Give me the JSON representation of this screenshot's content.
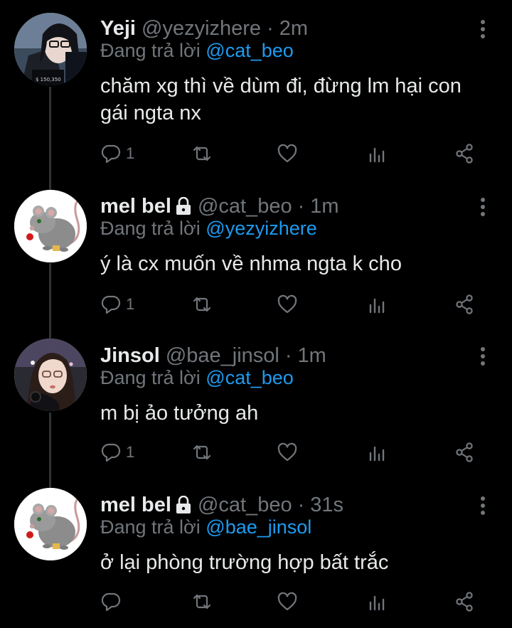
{
  "tweets": [
    {
      "name": "Yeji",
      "handle": "@yezyizhere",
      "separator": "·",
      "time": "2m",
      "locked": false,
      "reply_prefix": "Đang trả lời",
      "reply_to": "@cat_beo",
      "text_lines": [
        "chăm xg thì về dùm đi, đừng lm hại con",
        "gái ngta nx"
      ],
      "reply_count": "1",
      "avatar": "yeji-avatar"
    },
    {
      "name": "mel bel",
      "handle": "@cat_beo",
      "separator": "·",
      "time": "1m",
      "locked": true,
      "reply_prefix": "Đang trả lời",
      "reply_to": "@yezyizhere",
      "text_lines": [
        "ý là cx muốn về nhma ngta k cho"
      ],
      "reply_count": "1",
      "avatar": "rat-avatar"
    },
    {
      "name": "Jinsol",
      "handle": "@bae_jinsol",
      "separator": "·",
      "time": "1m",
      "locked": false,
      "reply_prefix": "Đang trả lời",
      "reply_to": "@cat_beo",
      "text_lines": [
        "m bị ảo tưởng ah"
      ],
      "reply_count": "1",
      "avatar": "jinsol-avatar"
    },
    {
      "name": "mel bel",
      "handle": "@cat_beo",
      "separator": "·",
      "time": "31s",
      "locked": true,
      "reply_prefix": "Đang trả lời",
      "reply_to": "@bae_jinsol",
      "text_lines": [
        "ở lại phòng trường hợp bất trắc"
      ],
      "reply_count": "",
      "avatar": "rat-avatar"
    }
  ],
  "colors": {
    "background": "#000000",
    "text": "#e7e9ea",
    "muted": "#71767b",
    "link": "#1d9bf0",
    "connector": "#2f3336"
  },
  "icons": [
    "reply-icon",
    "retweet-icon",
    "like-icon",
    "analytics-icon",
    "share-icon",
    "more-icon",
    "lock-icon"
  ]
}
